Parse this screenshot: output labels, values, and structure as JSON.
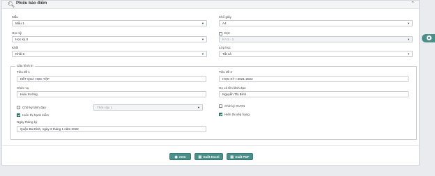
{
  "header": {
    "title": "Phiếu báo điểm",
    "search_icon": "search-icon",
    "collapse_icon": "chevrons-up-icon"
  },
  "form": {
    "mau": {
      "label": "Mẫu",
      "value": "Mẫu 1"
    },
    "kho_giay": {
      "label": "Khổ giấy",
      "value": "A4"
    },
    "hoc_ky": {
      "label": "Học kỳ",
      "value": "Học kỳ II"
    },
    "dot": {
      "label": "Đợt",
      "value": "KA 2 - 1",
      "checked": false
    },
    "khoi": {
      "label": "Khối",
      "value": "Khối 6"
    },
    "lop_hoc": {
      "label": "Lớp học",
      "value": "Tất cả"
    }
  },
  "config": {
    "legend": "Cấu hình in",
    "tieu_de_1": {
      "label": "Tiêu đề 1",
      "value": "KẾT QUẢ HỌC TẬP"
    },
    "tieu_de_2": {
      "label": "Tiêu đề 2",
      "value": "HỌC KỲ I-2021-2022"
    },
    "chuc_vu": {
      "label": "Chức vụ",
      "value": "Hiệu trưởng"
    },
    "ho_ten": {
      "label": "Họ và tên lãnh đạo",
      "value": "Nguyễn Thị Bình"
    },
    "chu_ky_lanh_dao": {
      "label": "Chữ ký lãnh đạo",
      "checked": false
    },
    "chu_ky_select": {
      "value": "Thời cấp 1"
    },
    "chu_ky_gvcn": {
      "label": "Chữ ký GVCN",
      "checked": false
    },
    "hien_thi_hanh_kiem": {
      "label": "Hiển thị hạnh kiểm",
      "checked": true
    },
    "hien_thi_xep_hang": {
      "label": "Hiển thị xếp hạng",
      "checked": true
    },
    "ngay_thang": {
      "label": "Ngày tháng ký",
      "value": "Quận Ba Đình, ngày 3 tháng 1 năm 2022"
    }
  },
  "actions": {
    "xem": "Xem",
    "xuat_excel": "Xuất Excel",
    "xuat_pdf": "Xuất PDF"
  },
  "colors": {
    "accent": "#4a8f8a"
  }
}
